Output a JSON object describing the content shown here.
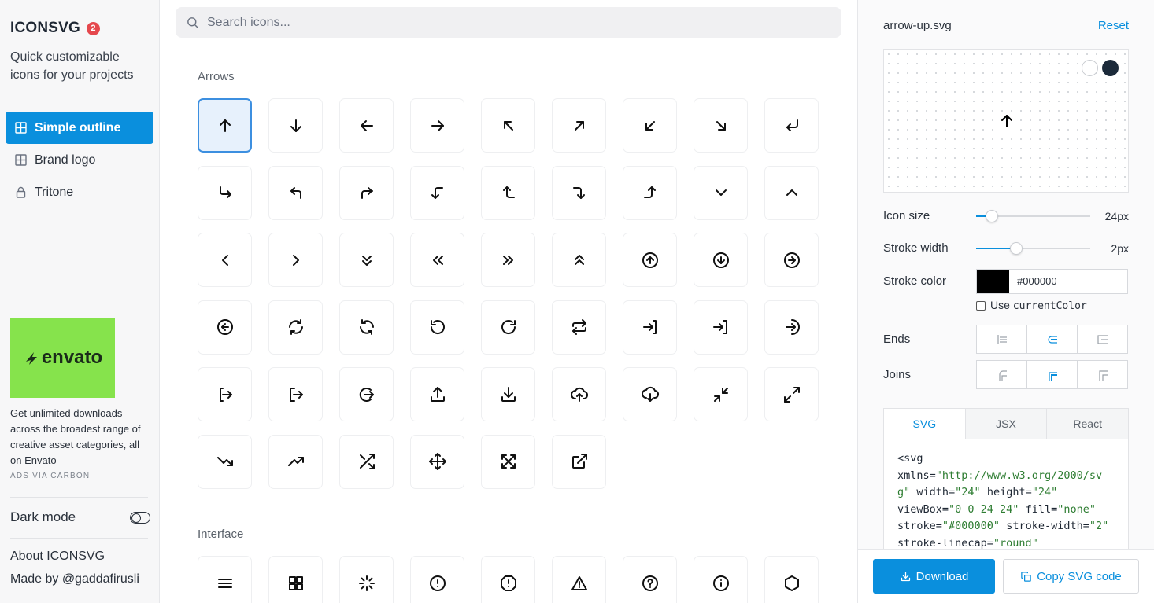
{
  "sidebar": {
    "brand": "ICONSVG",
    "badge": "2",
    "tagline": "Quick customizable icons for your projects",
    "nav": [
      {
        "label": "Simple outline",
        "icon": "grid-icon"
      },
      {
        "label": "Brand logo",
        "icon": "grid-icon"
      },
      {
        "label": "Tritone",
        "icon": "lock-icon"
      }
    ],
    "ad": {
      "logo_text": "envato",
      "text": "Get unlimited downloads across the broadest range of creative asset categories, all on Envato",
      "via": "ADS VIA CARBON"
    },
    "dark_mode": "Dark mode",
    "about": "About ICONSVG",
    "made_by": "Made by @gaddafirusli"
  },
  "search": {
    "placeholder": "Search icons..."
  },
  "sections": [
    {
      "title": "Arrows"
    },
    {
      "title": "Interface"
    }
  ],
  "panel": {
    "filename": "arrow-up.svg",
    "reset": "Reset",
    "icon_size_label": "Icon size",
    "icon_size_value": "24px",
    "icon_size_level": 0.14,
    "stroke_width_label": "Stroke width",
    "stroke_width_value": "2px",
    "stroke_width_level": 0.35,
    "stroke_color_label": "Stroke color",
    "stroke_color_value": "#000000",
    "use_current_color_prefix": "Use ",
    "use_current_color_code": "currentColor",
    "ends_label": "Ends",
    "joins_label": "Joins",
    "tabs": [
      "SVG",
      "JSX",
      "React"
    ],
    "download": "Download",
    "copy": "Copy SVG code"
  },
  "colors": {
    "accent": "#0a8fdd",
    "selected_bg": "#e7f1fc",
    "ad_green": "#86e34c",
    "badge": "#e5484d"
  }
}
